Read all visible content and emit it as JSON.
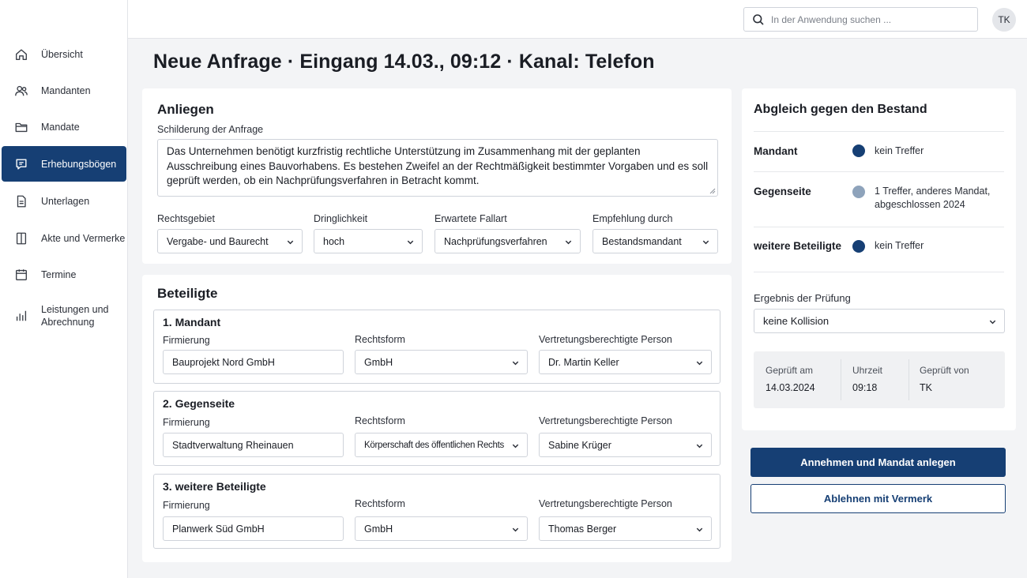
{
  "sidebar": {
    "items": [
      {
        "label": "Übersicht",
        "icon": "home-icon"
      },
      {
        "label": "Mandanten",
        "icon": "users-icon"
      },
      {
        "label": "Mandate",
        "icon": "folder-icon"
      },
      {
        "label": "Erhebungsbögen",
        "icon": "form-icon",
        "active": true
      },
      {
        "label": "Unterlagen",
        "icon": "document-icon"
      },
      {
        "label": "Akte und Vermerke",
        "icon": "notebook-icon"
      },
      {
        "label": "Termine",
        "icon": "calendar-icon"
      },
      {
        "label": "Leistungen und\nAbrechnung",
        "icon": "bar-chart-icon"
      }
    ]
  },
  "topbar": {
    "search_placeholder": "In der Anwendung suchen ...",
    "avatar_initials": "TK"
  },
  "page": {
    "title": "Neue Anfrage · Eingang 14.03., 09:12 · Kanal: Telefon"
  },
  "anliegen": {
    "title": "Anliegen",
    "description_label": "Schilderung der Anfrage",
    "description_text": "Das Unternehmen benötigt kurzfristig rechtliche Unterstützung im Zusammenhang mit der geplanten Ausschreibung eines Bauvorhabens. Es bestehen Zweifel an der Rechtmäßigkeit bestimmter Vorgaben und es soll geprüft werden, ob ein Nachprüfungsverfahren in Betracht kommt.",
    "fields": [
      {
        "label": "Rechtsgebiet",
        "value": "Vergabe- und Baurecht"
      },
      {
        "label": "Dringlichkeit",
        "value": "hoch"
      },
      {
        "label": "Erwartete Fallart",
        "value": "Nachprüfungsverfahren"
      },
      {
        "label": "Empfehlung durch",
        "value": "Bestandsmandant"
      }
    ]
  },
  "beteiligte": {
    "title": "Beteiligte",
    "col_firmierung": "Firmierung",
    "col_rechtsform": "Rechtsform",
    "col_person": "Vertretungsberechtigte Person",
    "parties": [
      {
        "title": "1. Mandant",
        "firmierung": "Bauprojekt Nord GmbH",
        "rechtsform": "GmbH",
        "person": "Dr. Martin Keller"
      },
      {
        "title": "2. Gegenseite",
        "firmierung": "Stadtverwaltung Rheinauen",
        "rechtsform": "Körperschaft des öffentlichen Rechts",
        "person": "Sabine Krüger"
      },
      {
        "title": "3. weitere Beteiligte",
        "firmierung": "Planwerk Süd GmbH",
        "rechtsform": "GmbH",
        "person": "Thomas Berger"
      }
    ]
  },
  "abgleich": {
    "title": "Abgleich gegen den Bestand",
    "rows": [
      {
        "key": "Mandant",
        "status": "kein Treffer",
        "color": "#163f74"
      },
      {
        "key": "Gegenseite",
        "status": "1 Treffer, anderes Mandat,\nabgeschlossen 2024",
        "color": "#8ea3bb"
      },
      {
        "key": "weitere Beteiligte",
        "status": "kein Treffer",
        "color": "#163f74"
      }
    ],
    "result_label": "Ergebnis der Prüfung",
    "result_value": "keine Kollision",
    "checked": {
      "date_label": "Geprüft am",
      "date_value": "14.03.2024",
      "time_label": "Uhrzeit",
      "time_value": "09:18",
      "by_label": "Geprüft von",
      "by_value": "TK"
    }
  },
  "actions": {
    "accept_label": "Annehmen und Mandat anlegen",
    "reject_label": "Ablehnen mit Vermerk"
  },
  "colors": {
    "primary": "#163f74",
    "dot_muted": "#8ea3bb"
  }
}
